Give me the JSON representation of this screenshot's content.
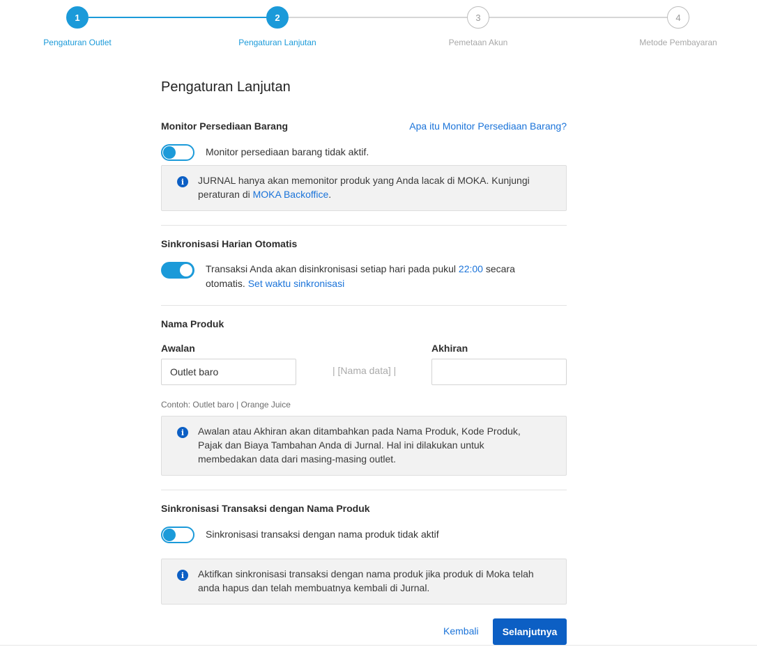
{
  "stepper": {
    "steps": [
      {
        "number": "1",
        "label": "Pengaturan Outlet",
        "state": "completed"
      },
      {
        "number": "2",
        "label": "Pengaturan Lanjutan",
        "state": "active"
      },
      {
        "number": "3",
        "label": "Pemetaan Akun",
        "state": "inactive"
      },
      {
        "number": "4",
        "label": "Metode Pembayaran",
        "state": "inactive"
      }
    ]
  },
  "page_title": "Pengaturan Lanjutan",
  "inventory": {
    "title": "Monitor Persediaan Barang",
    "help_link": "Apa itu Monitor Persediaan Barang?",
    "toggle_state": "off",
    "toggle_text": "Monitor persediaan barang tidak aktif.",
    "info_text": "JURNAL hanya akan memonitor produk yang Anda lacak di MOKA. Kunjungi peraturan di ",
    "info_link": "MOKA Backoffice",
    "info_suffix": "."
  },
  "daily_sync": {
    "title": "Sinkronisasi Harian Otomatis",
    "toggle_state": "on",
    "text_before": "Transaksi Anda akan disinkronisasi setiap hari pada pukul ",
    "time": "22:00",
    "text_after": " secara otomatis. ",
    "link": "Set waktu sinkronisasi"
  },
  "product_name": {
    "title": "Nama Produk",
    "prefix_label": "Awalan",
    "prefix_value": "Outlet baro",
    "middle_hint": "| [Nama data] |",
    "suffix_label": "Akhiran",
    "suffix_value": "",
    "example": "Contoh: Outlet baro | Orange Juice",
    "info_text": "Awalan atau Akhiran akan ditambahkan pada Nama Produk, Kode Produk, Pajak dan Biaya Tambahan Anda di Jurnal. Hal ini dilakukan untuk membedakan data dari masing-masing outlet."
  },
  "product_sync": {
    "title": "Sinkronisasi Transaksi dengan Nama Produk",
    "toggle_state": "off",
    "toggle_text": "Sinkronisasi transaksi dengan nama produk tidak aktif",
    "info_text": "Aktifkan sinkronisasi transaksi dengan nama produk jika produk di Moka telah anda hapus dan telah membuatnya kembali di Jurnal."
  },
  "actions": {
    "back_label": "Kembali",
    "next_label": "Selanjutnya"
  },
  "colors": {
    "accent": "#1b9ad9",
    "link": "#1a73d9",
    "primary_button": "#0c5fc4"
  }
}
